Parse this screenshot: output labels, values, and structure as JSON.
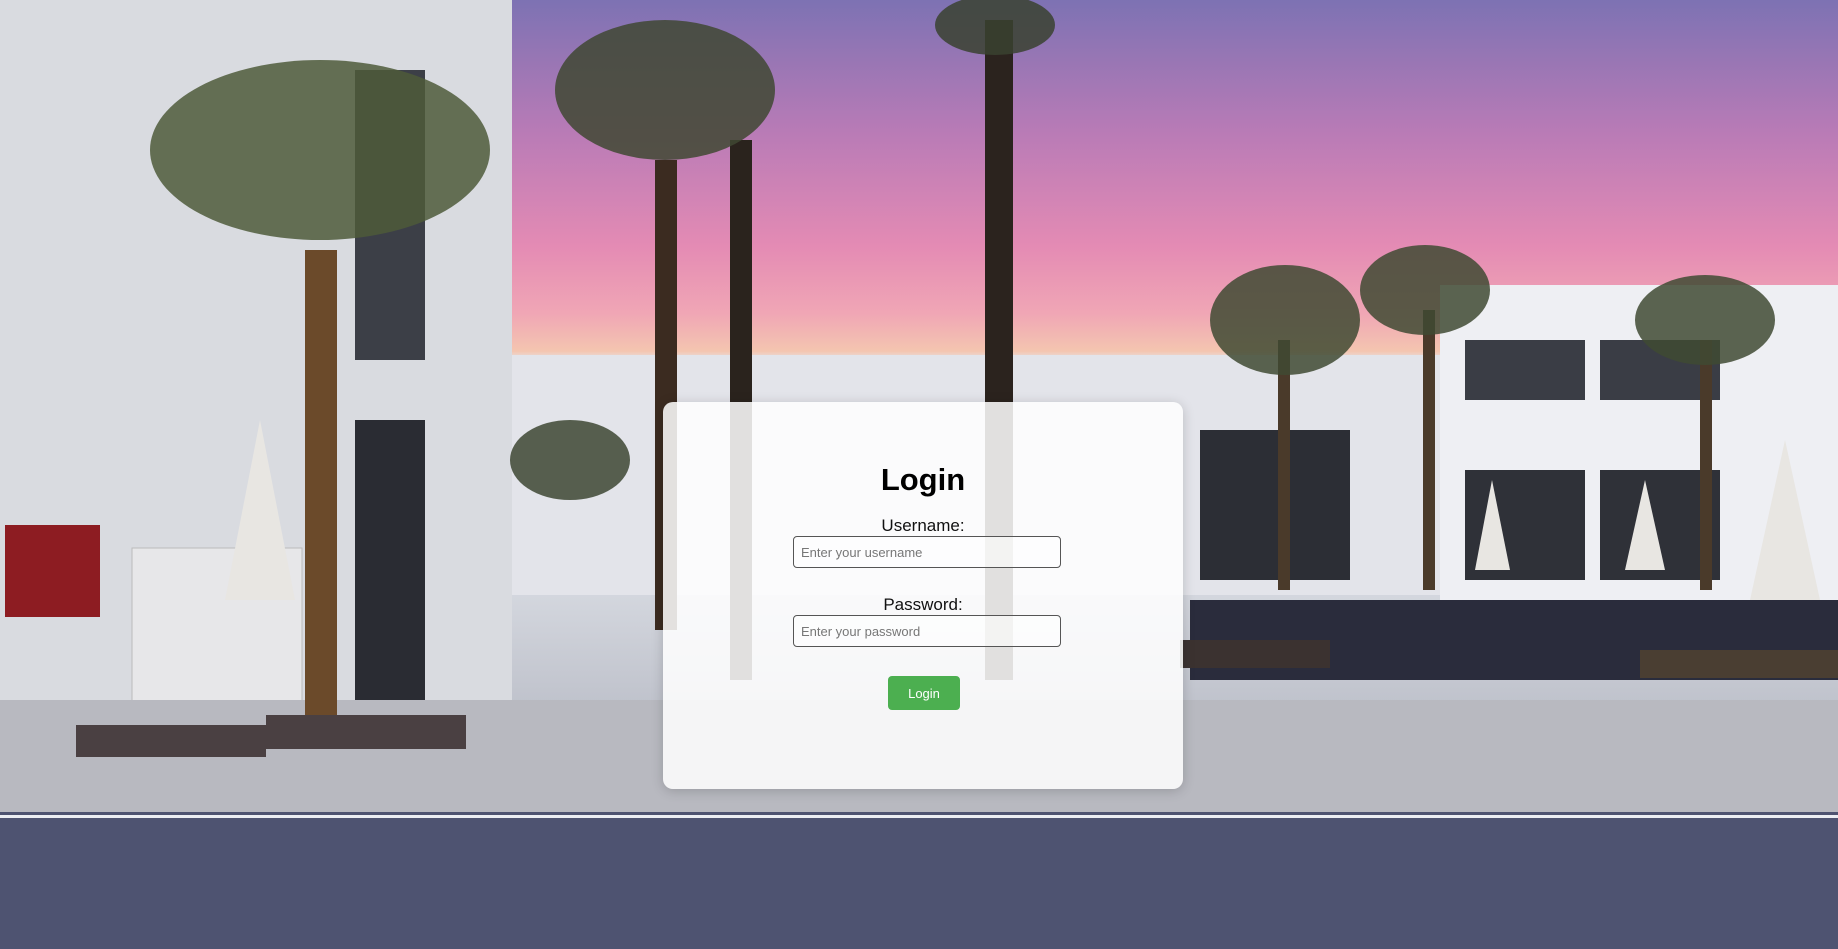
{
  "login": {
    "title": "Login",
    "username_label": "Username:",
    "username_placeholder": "Enter your username",
    "username_value": "",
    "password_label": "Password:",
    "password_placeholder": "Enter your password",
    "password_value": "",
    "submit_label": "Login"
  },
  "colors": {
    "button_bg": "#4caf50",
    "button_text": "#ffffff",
    "card_bg": "#ffffff"
  }
}
